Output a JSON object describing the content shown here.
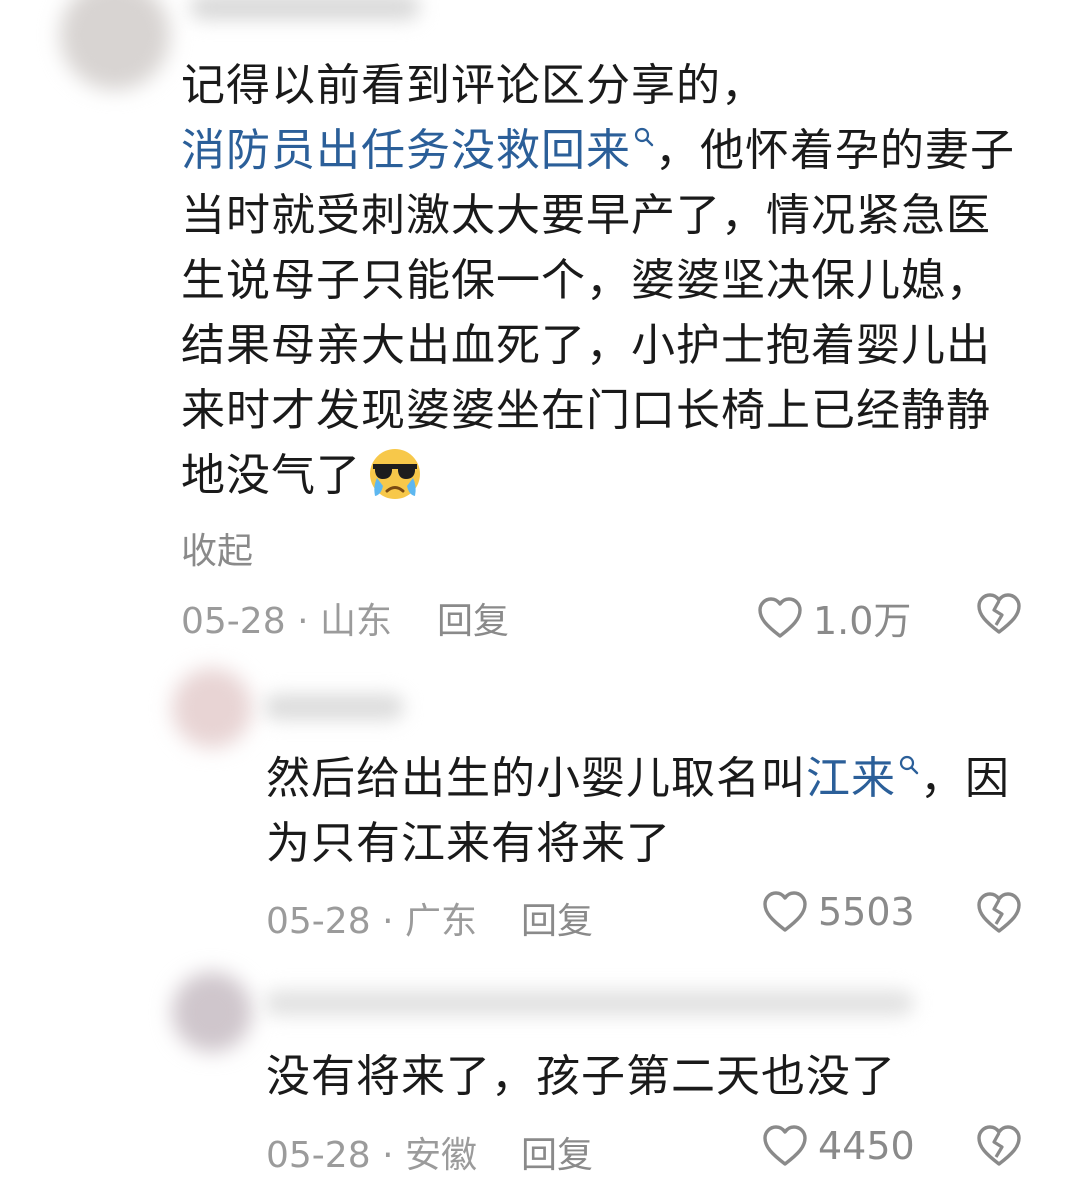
{
  "comments": [
    {
      "text_lines": [
        [
          "记得以前看到评论区分享的，"
        ],
        [
          "",
          "消防员出任务没救回来",
          "，他怀着孕的妻子"
        ],
        [
          "当时就受刺激太大要早产了，情况紧急医"
        ],
        [
          "生说母子只能保一个，婆婆坚决保儿媳，"
        ],
        [
          "结果母亲大出血死了，小护士抱着婴儿出"
        ],
        [
          "来时才发现婆婆坐在门口长椅上已经静静"
        ],
        [
          "地没气了"
        ]
      ],
      "collapse_label": "收起",
      "date": "05-28",
      "location": "山东",
      "reply_label": "回复",
      "likes": "1.0万"
    },
    {
      "line1_before": "然后给出生的小婴儿取名叫",
      "line1_link": "江来",
      "line1_after": "，因",
      "line2": "为只有江来有将来了",
      "date": "05-28",
      "location": "广东",
      "reply_label": "回复",
      "likes": "5503"
    },
    {
      "line1": "没有将来了，孩子第二天也没了",
      "date": "05-28",
      "location": "安徽",
      "reply_label": "回复",
      "likes": "4450"
    }
  ],
  "meta_separator": "·",
  "colors": {
    "link": "#2b5f99",
    "text": "#1a1a1a",
    "muted": "#9b9b9b"
  },
  "icons": [
    "heart-outline-icon",
    "broken-heart-icon",
    "search-icon",
    "sad-cool-face-emoji"
  ]
}
